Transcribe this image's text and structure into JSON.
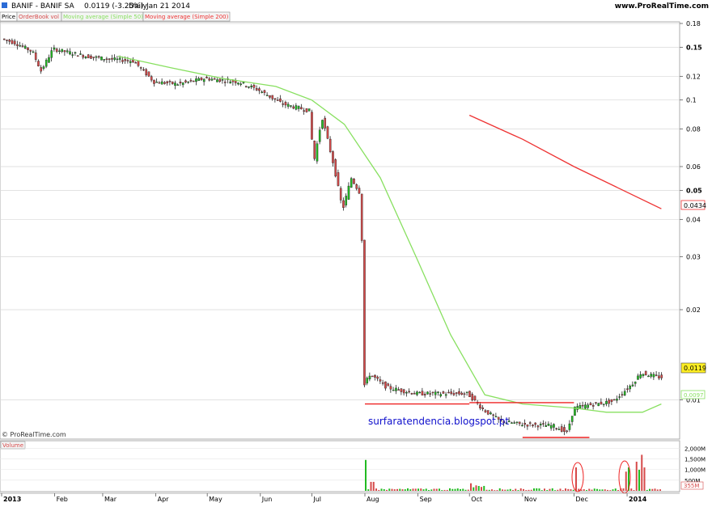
{
  "header": {
    "symbol": "BANIF - BANIF SA",
    "quote": "0.0119 (-3.25%)",
    "period": "Daily",
    "date": "Jan 21 2014",
    "site": "www.ProRealTime.com"
  },
  "legend": {
    "price": "Price",
    "orderbook": "OrderBook vol",
    "ma50": "Moving average (Simple 50)",
    "ma200": "Moving average (Simple 200)",
    "volume": "Volume"
  },
  "watermark": "surfaratendencia.blogspot.pt",
  "copyright": "© ProRealTime.com",
  "last_price_label": "0.0119",
  "ma200_label": "0.0434",
  "ma50_label": "0.0097",
  "colors": {
    "up": "#22bb22",
    "down": "#d64a4a",
    "ma50": "#88e060",
    "ma200": "#ee3333",
    "support": "#ee2222",
    "watermark": "#1010cc",
    "grid": "#d8d8d8"
  },
  "chart_data": {
    "type": "candlestick",
    "y_scale": "log",
    "price_ticks": [
      "0.18",
      "0.15",
      "0.12",
      "0.1",
      "0.08",
      "0.06",
      "0.05",
      "0.04",
      "0.03",
      "0.02",
      "0.01"
    ],
    "x_ticks": [
      "2013",
      "Feb",
      "Mar",
      "Apr",
      "May",
      "Jun",
      "Jul",
      "Aug",
      "Sep",
      "Oct",
      "Nov",
      "Dec",
      "2014"
    ],
    "close_path": [
      [
        "2013-01-02",
        0.16
      ],
      [
        "2013-01-10",
        0.155
      ],
      [
        "2013-01-20",
        0.145
      ],
      [
        "2013-01-25",
        0.125
      ],
      [
        "2013-02-01",
        0.148
      ],
      [
        "2013-02-20",
        0.14
      ],
      [
        "2013-03-05",
        0.137
      ],
      [
        "2013-03-20",
        0.135
      ],
      [
        "2013-04-01",
        0.115
      ],
      [
        "2013-04-15",
        0.113
      ],
      [
        "2013-05-01",
        0.118
      ],
      [
        "2013-05-20",
        0.115
      ],
      [
        "2013-06-01",
        0.108
      ],
      [
        "2013-06-15",
        0.097
      ],
      [
        "2013-07-01",
        0.092
      ],
      [
        "2013-07-03",
        0.061
      ],
      [
        "2013-07-08",
        0.088
      ],
      [
        "2013-07-15",
        0.06
      ],
      [
        "2013-07-20",
        0.043
      ],
      [
        "2013-07-25",
        0.055
      ],
      [
        "2013-07-31",
        0.048
      ],
      [
        "2013-08-01",
        0.011
      ],
      [
        "2013-08-05",
        0.0122
      ],
      [
        "2013-08-15",
        0.011
      ],
      [
        "2013-09-01",
        0.0105
      ],
      [
        "2013-10-01",
        0.0105
      ],
      [
        "2013-10-10",
        0.0093
      ],
      [
        "2013-10-20",
        0.0085
      ],
      [
        "2013-11-01",
        0.0083
      ],
      [
        "2013-11-20",
        0.0082
      ],
      [
        "2013-11-28",
        0.0078
      ],
      [
        "2013-12-02",
        0.0094
      ],
      [
        "2013-12-10",
        0.0096
      ],
      [
        "2013-12-25",
        0.0099
      ],
      [
        "2014-01-05",
        0.0113
      ],
      [
        "2014-01-10",
        0.0123
      ],
      [
        "2014-01-21",
        0.0119
      ]
    ],
    "ma50": [
      [
        "2013-03-10",
        0.14
      ],
      [
        "2013-04-10",
        0.128
      ],
      [
        "2013-05-10",
        0.118
      ],
      [
        "2013-06-10",
        0.111
      ],
      [
        "2013-07-01",
        0.1
      ],
      [
        "2013-07-20",
        0.083
      ],
      [
        "2013-08-10",
        0.055
      ],
      [
        "2013-09-01",
        0.029
      ],
      [
        "2013-09-20",
        0.0165
      ],
      [
        "2013-10-10",
        0.0104
      ],
      [
        "2013-11-01",
        0.0097
      ],
      [
        "2013-12-01",
        0.0094
      ],
      [
        "2013-12-20",
        0.0091
      ],
      [
        "2014-01-10",
        0.0091
      ],
      [
        "2014-01-21",
        0.0097
      ]
    ],
    "ma200": [
      [
        "2013-10-01",
        0.089
      ],
      [
        "2013-11-01",
        0.074
      ],
      [
        "2013-12-01",
        0.06
      ],
      [
        "2014-01-21",
        0.0434
      ]
    ],
    "support_lines": [
      {
        "from": "2013-08-01",
        "to": "2013-10-01",
        "value": 0.0097
      },
      {
        "from": "2013-10-01",
        "to": "2013-12-01",
        "value": 0.0098
      },
      {
        "from": "2013-11-01",
        "to": "2013-12-10",
        "value": 0.0075
      }
    ],
    "volume": {
      "ticks": [
        "2,000M",
        "1,500M",
        "1,000M",
        "500M"
      ],
      "last_label": "355M"
    }
  }
}
